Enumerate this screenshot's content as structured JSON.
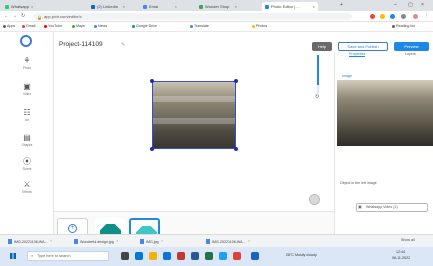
{
  "browser": {
    "tabs": [
      {
        "label": "Whatsapp",
        "color": "#25d366"
      },
      {
        "label": "(2) LinkedIn",
        "color": "#0a66c2"
      },
      {
        "label": "Emai",
        "color": "#4285f4"
      },
      {
        "label": "Wonder Shop",
        "color": "#34a853"
      },
      {
        "label": "Photo Editor | ...",
        "color": "#1e88e5"
      }
    ],
    "url": "app.pixlr.com/editor/x",
    "bookmarks": [
      "Apps",
      "Gmail",
      "YouTube",
      "Maps",
      "News",
      "Google Drive",
      "Translate",
      "Photos"
    ],
    "reading_list": "Reading list"
  },
  "app": {
    "project_title": "Project-114109",
    "help_label": "Help",
    "save_publish_label": "Save and Publish",
    "preview_label": "Preview",
    "sidebar": [
      {
        "icon": "photos-icon",
        "glyph": "⚘",
        "label": "Photo"
      },
      {
        "icon": "video-icon",
        "glyph": "▣",
        "label": "Video"
      },
      {
        "icon": "audio-icon",
        "glyph": "☷",
        "label": "Art"
      },
      {
        "icon": "shapes-icon",
        "glyph": "▤",
        "label": "Shapes"
      },
      {
        "icon": "text-icon",
        "glyph": "⦿",
        "label": "Scene"
      },
      {
        "icon": "settings-icon",
        "glyph": "⚔",
        "label": "Effects"
      }
    ],
    "strip": {
      "add_label": "Add New Scene"
    },
    "panel": {
      "tabs": [
        "Properties",
        "Layers"
      ],
      "section_label": "Image",
      "caption": "Object in the left image",
      "field_value": "Whatsapp Video (1)"
    }
  },
  "downloads": [
    {
      "label": "IMG-20221108-WA..."
    },
    {
      "label": "Wonderful design.jpg"
    },
    {
      "label": "IMG.jpg"
    },
    {
      "label": "IMG-20221108-WA..."
    }
  ],
  "downloads_show_all": "Show all",
  "taskbar": {
    "search_placeholder": "Type here to search",
    "weather": "28°C Mostly cloudy",
    "time": "12:44",
    "date": "08-11-2022"
  }
}
